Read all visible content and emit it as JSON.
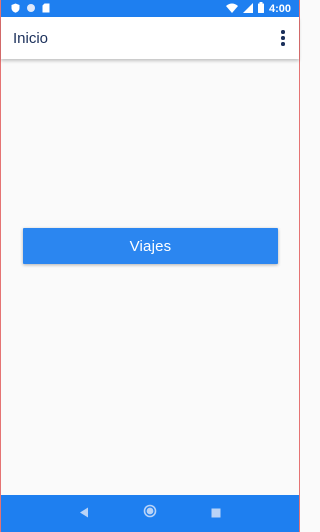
{
  "status_bar": {
    "time": "4:00",
    "icons": [
      "shield-icon",
      "circle-icon",
      "sd-card-icon",
      "wifi-icon",
      "signal-icon",
      "battery-icon"
    ],
    "color": "#1e7ff0"
  },
  "app_bar": {
    "title": "Inicio",
    "menu_icon": "more-vert-icon"
  },
  "main": {
    "viajes_button_label": "Viajes",
    "button_color": "#2b86f0"
  },
  "nav_bar": {
    "icons": [
      "back-icon",
      "home-icon",
      "recents-icon"
    ],
    "color": "#1e7ff0"
  }
}
